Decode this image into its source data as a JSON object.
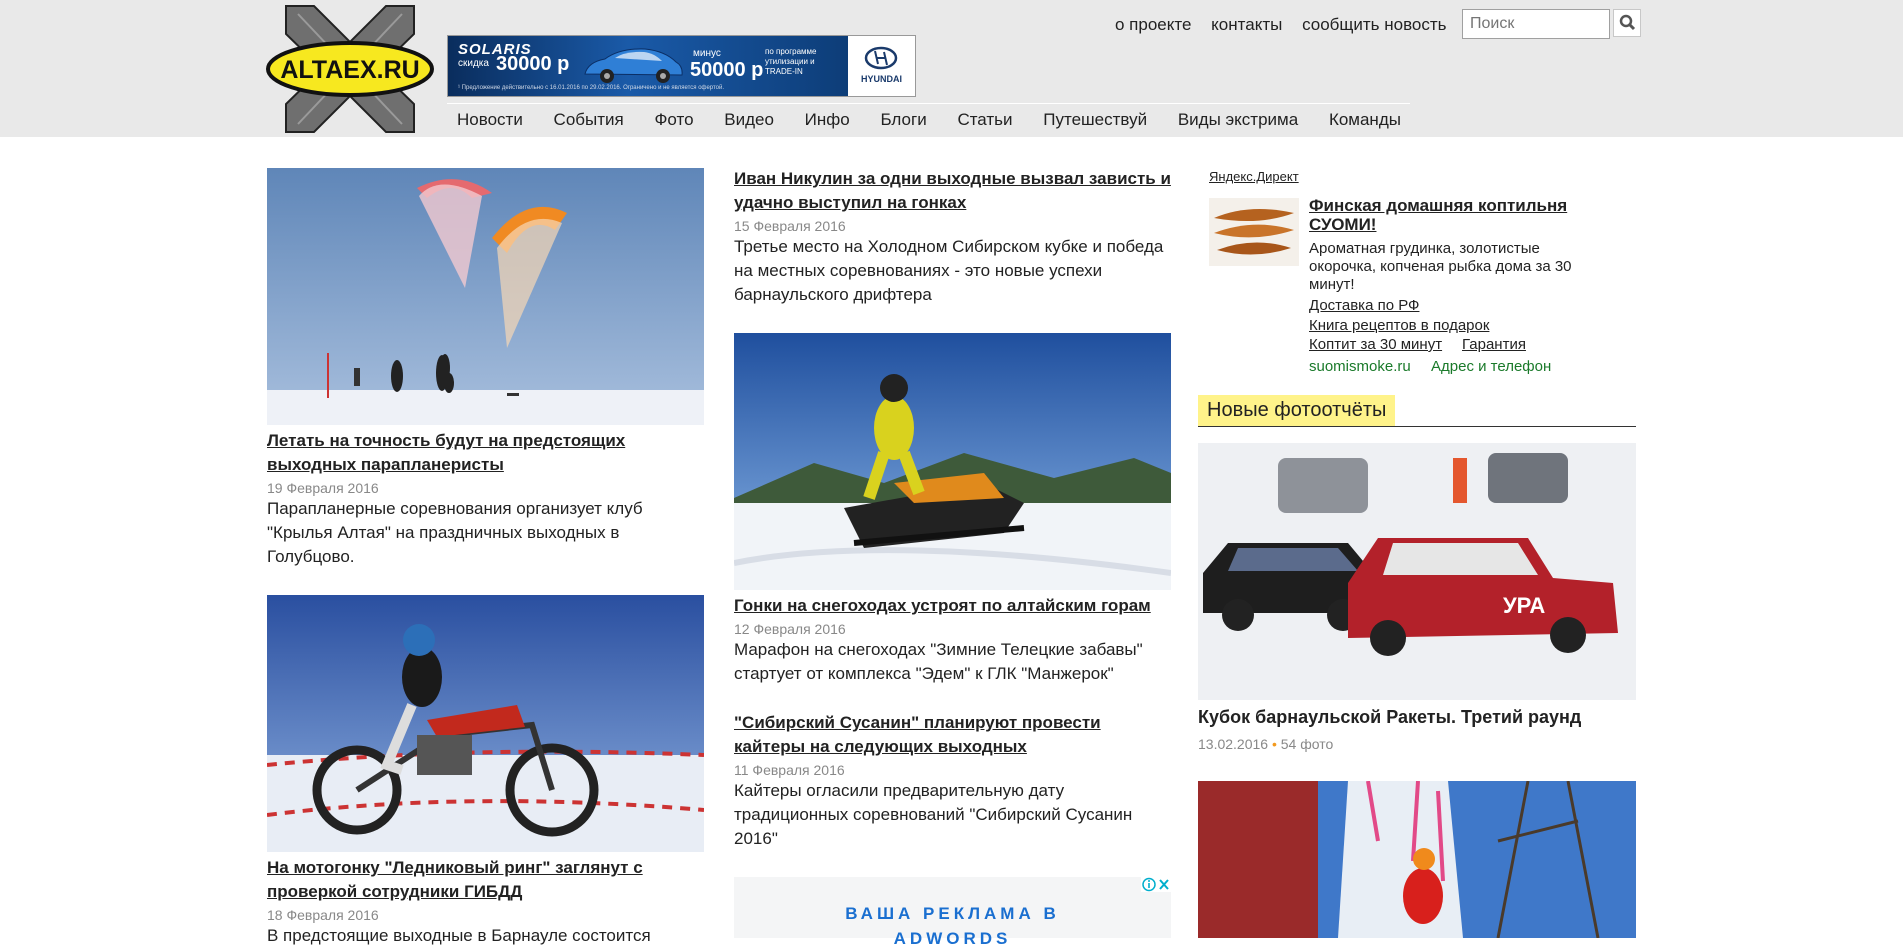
{
  "site": {
    "logo_text": "ALTAEX.RU",
    "top_links": [
      "о проекте",
      "контакты",
      "сообщить новость"
    ],
    "search_placeholder": "Поиск",
    "nav": [
      "Новости",
      "События",
      "Фото",
      "Видео",
      "Инфо",
      "Блоги",
      "Статьи",
      "Путешествуй",
      "Виды экстрима",
      "Команды"
    ]
  },
  "banner": {
    "model": "SOLARIS",
    "discount_label": "скидка",
    "discount_value": "30000 р",
    "minus_label": "минус",
    "minus_value": "50000 р",
    "program_text": "по программе утилизации и TRADE-IN",
    "disclaimer": "¹ Предложение действительно с 16.01.2016 по 29.02.2016. Ограничено и не является офертой.",
    "brand": "HYUNDAI"
  },
  "news_left": [
    {
      "title": "Летать на точность будут на предстоящих выходных парапланеристы",
      "date": "19 Февраля 2016",
      "desc": "Парапланерные соревнования организует клуб \"Крылья Алтая\" на праздничных выходных в Голубцово."
    },
    {
      "title": "На мотогонку \"Ледниковый ринг\" заглянут с проверкой сотрудники ГИБДД",
      "date": "18 Февраля 2016",
      "desc": "В предстоящие выходные в Барнауле состоится"
    }
  ],
  "news_mid": [
    {
      "title": "Иван Никулин за одни выходные вызвал зависть и удачно выступил на гонках",
      "date": "15 Февраля 2016",
      "desc": "Третье место на Холодном Сибирском кубке и победа на местных соревнованиях - это новые успехи барнаульского дрифтера"
    },
    {
      "title": "Гонки на снегоходах устроят по алтайским горам",
      "date": "12 Февраля 2016",
      "desc": "Марафон на снегоходах \"Зимние Телецкие забавы\" стартует от комплекса \"Эдем\" к ГЛК \"Манжерок\""
    },
    {
      "title": "\"Сибирский Сусанин\" планируют провести кайтеры на следующих выходных",
      "date": "11 Февраля 2016",
      "desc": "Кайтеры огласили предварительную дату традиционных соревнований \"Сибирский Сусанин 2016\""
    }
  ],
  "ad": {
    "line1": "ВАША РЕКЛАМА В",
    "line2": "ADWORDS"
  },
  "direct": {
    "label": "Яндекс.Директ",
    "title": "Финская домашняя коптильня СУОМИ!",
    "text": "Ароматная грудинка, золотистые окорочка, копченая рыбка дома за 30 минут!",
    "link1": "Доставка по РФ",
    "link2": "Книга рецептов в подарок",
    "link3": "Коптит за 30 минут",
    "link4": "Гарантия",
    "domain": "suomismoke.ru",
    "address": "Адрес и телефон"
  },
  "photoreports": {
    "heading": "Новые фотоотчёты",
    "items": [
      {
        "title": "Кубок барнаульской Ракеты. Третий раунд",
        "date": "13.02.2016",
        "count": "54 фото"
      }
    ]
  },
  "colors": {
    "header_bg": "#e9e9e9",
    "logo_yellow": "#f7e81f",
    "section_highlight": "#fff38a",
    "green_link": "#1a7a2a",
    "ad_blue": "#1a6fd0"
  }
}
